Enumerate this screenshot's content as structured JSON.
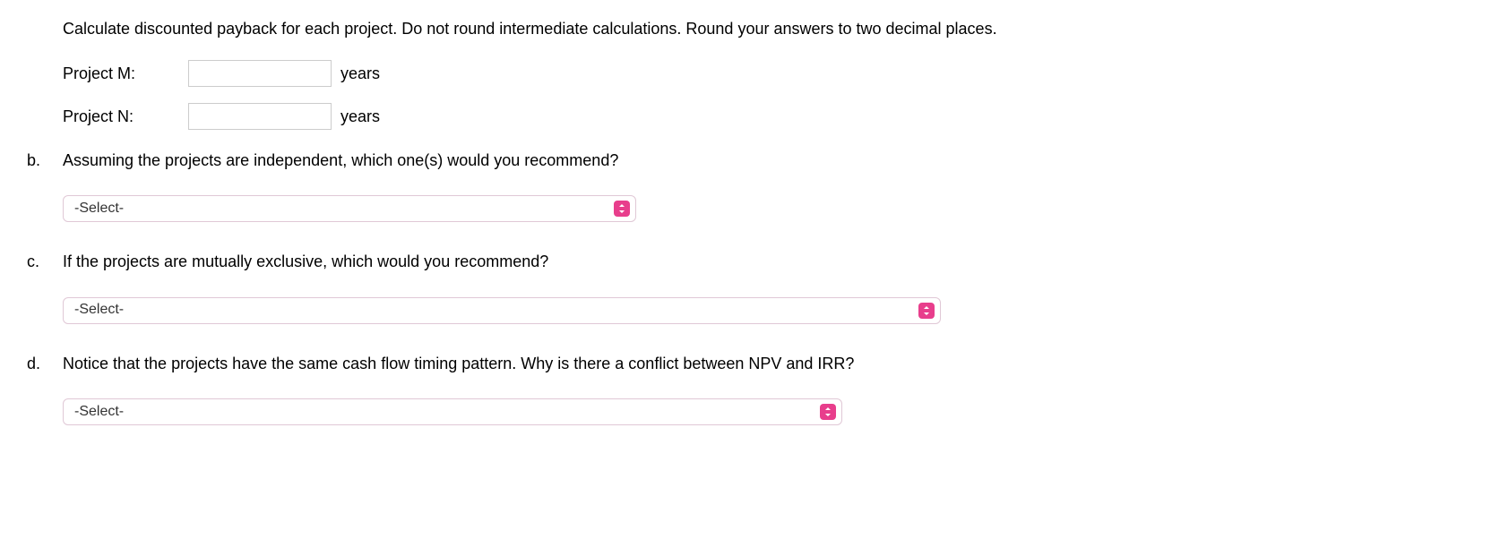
{
  "intro": "Calculate discounted payback for each project. Do not round intermediate calculations. Round your answers to two decimal places.",
  "projects": {
    "m": {
      "label": "Project M:",
      "value": "",
      "unit": "years"
    },
    "n": {
      "label": "Project N:",
      "value": "",
      "unit": "years"
    }
  },
  "questions": {
    "b": {
      "marker": "b.",
      "text": "Assuming the projects are independent, which one(s) would you recommend?",
      "select_placeholder": "-Select-"
    },
    "c": {
      "marker": "c.",
      "text": "If the projects are mutually exclusive, which would you recommend?",
      "select_placeholder": "-Select-"
    },
    "d": {
      "marker": "d.",
      "text": "Notice that the projects have the same cash flow timing pattern. Why is there a conflict between NPV and IRR?",
      "select_placeholder": "-Select-"
    }
  }
}
